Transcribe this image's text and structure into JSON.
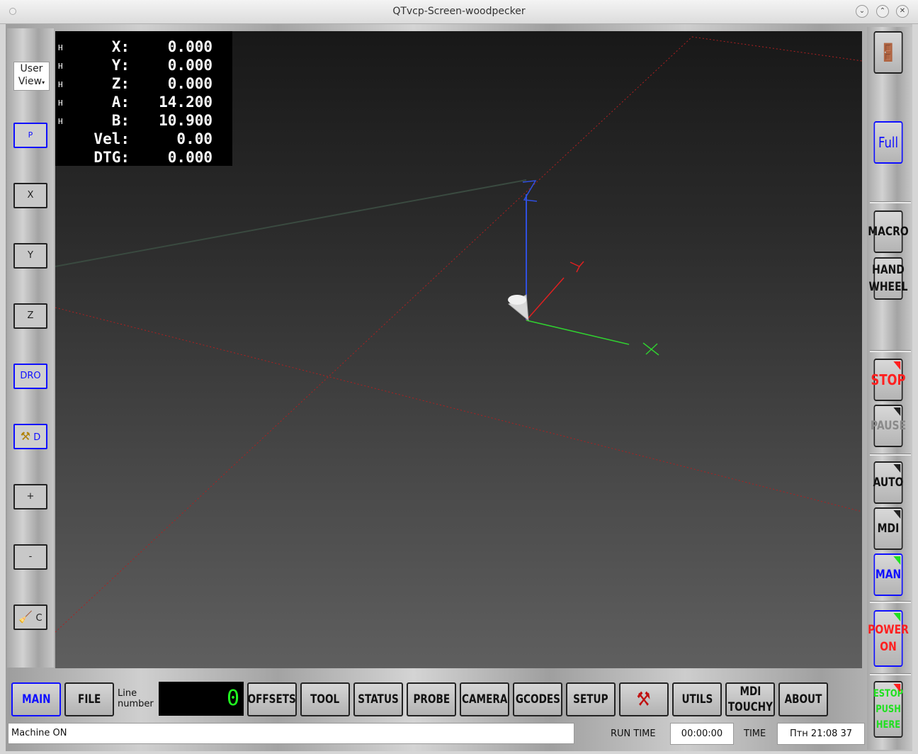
{
  "window": {
    "title": "QTvcp-Screen-woodpecker"
  },
  "dro": {
    "rows": [
      {
        "homed": "H",
        "label": "X:",
        "value": "0.000"
      },
      {
        "homed": "H",
        "label": "Y:",
        "value": "0.000"
      },
      {
        "homed": "H",
        "label": "Z:",
        "value": "0.000"
      },
      {
        "homed": "H",
        "label": "A:",
        "value": "14.200"
      },
      {
        "homed": "H",
        "label": "B:",
        "value": "10.900"
      },
      {
        "homed": "",
        "label": "Vel:",
        "value": "0.00"
      },
      {
        "homed": "",
        "label": "DTG:",
        "value": "0.000"
      }
    ]
  },
  "view_select": {
    "line1": "User",
    "line2": "View"
  },
  "left_buttons": {
    "p": "P",
    "x": "X",
    "y": "Y",
    "z": "Z",
    "dro": "DRO",
    "d": "D",
    "plus": "+",
    "minus": "-",
    "c": "C"
  },
  "right_buttons": {
    "full": "Full",
    "macro": "MACRO",
    "hand_1": "HAND",
    "hand_2": "WHEEL",
    "stop": "STOP",
    "pause": "PAUSE",
    "auto": "AUTO",
    "mdi": "MDI",
    "man": "MAN",
    "power_1": "POWER",
    "power_2": "ON",
    "estop_1": "ESTOP",
    "estop_2": "PUSH",
    "estop_3": "HERE"
  },
  "axes_labels": {
    "x": "X",
    "y": "Y",
    "z": "Z"
  },
  "bottom_tabs": {
    "main": "MAIN",
    "file": "FILE",
    "offsets": "OFFSETS",
    "tool": "TOOL",
    "status": "STATUS",
    "probe": "PROBE",
    "camera": "CAMERA",
    "gcodes": "GCODES",
    "setup": "SETUP",
    "utils": "UTILS",
    "mdi_touchy_1": "MDI",
    "mdi_touchy_2": "TOUCHY",
    "about": "ABOUT"
  },
  "line_number": {
    "label1": "Line",
    "label2": "number",
    "value": "0"
  },
  "statusbar": {
    "message": "Machine ON",
    "run_time_label": "RUN TIME",
    "run_time": "00:00:00",
    "time_label": "TIME",
    "time": "Птн 21:08 37"
  },
  "colors": {
    "active_blue": "#1010ff",
    "stop_red": "#ff2020",
    "led_green": "#20e020",
    "lcd_green": "#20ff20"
  }
}
